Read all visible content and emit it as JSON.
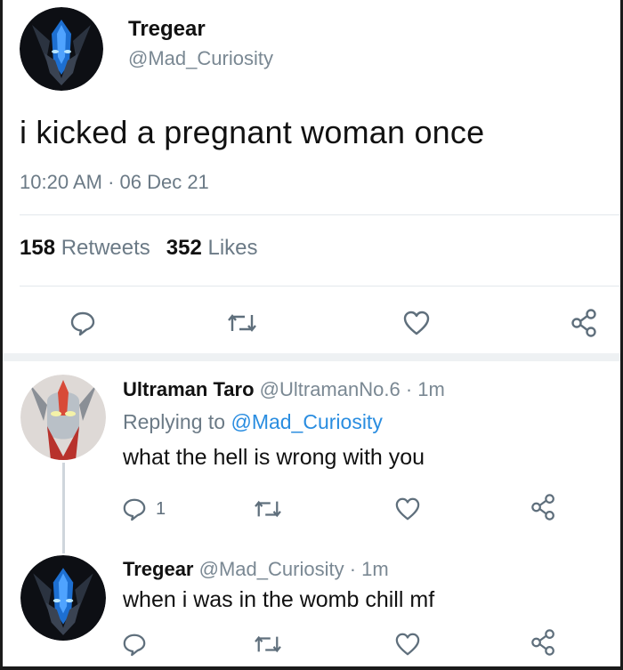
{
  "tweet": {
    "author_name": "Tregear",
    "author_handle": "@Mad_Curiosity",
    "text": "i kicked a pregnant woman once",
    "timestamp": "10:20 AM · 06 Dec 21",
    "retweets_count": "158",
    "retweets_label": "Retweets",
    "likes_count": "352",
    "likes_label": "Likes"
  },
  "replies": [
    {
      "author_name": "Ultraman Taro",
      "author_handle": "@UltramanNo.6",
      "time": "· 1m",
      "replying_to_label": "Replying to",
      "replying_to_handle": "@Mad_Curiosity",
      "text": "what the hell is wrong with you",
      "reply_count": "1"
    },
    {
      "author_name": "Tregear",
      "author_handle": "@Mad_Curiosity",
      "time": "· 1m",
      "text": "when i was in the womb chill mf"
    }
  ],
  "icons": {
    "reply": "reply-icon",
    "retweet": "retweet-icon",
    "like": "heart-icon",
    "share": "share-icon"
  },
  "colors": {
    "mention": "#2a8de0",
    "muted": "#6b7a86",
    "icon": "#5f6f7c",
    "divider": "#e3e8ec"
  }
}
